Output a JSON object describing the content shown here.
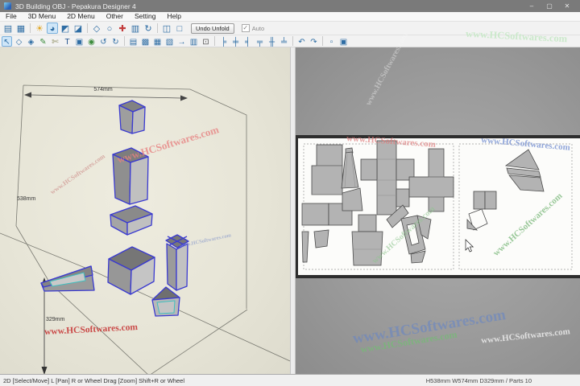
{
  "window": {
    "title": "3D Building OBJ - Pepakura Designer 4",
    "minimize_glyph": "–",
    "maximize_glyph": "▢",
    "close_glyph": "✕"
  },
  "menubar": {
    "items": [
      "File",
      "3D Menu",
      "2D Menu",
      "Other",
      "Setting",
      "Help"
    ]
  },
  "toolbar_top": {
    "icons": [
      {
        "name": "open-file",
        "glyph": "▤",
        "color": "#2e6da4"
      },
      {
        "name": "save-file",
        "glyph": "▦",
        "color": "#2e6da4"
      },
      {
        "sep": true
      },
      {
        "name": "toggle-light",
        "glyph": "☀",
        "color": "#e0a520"
      },
      {
        "name": "rotate-view",
        "glyph": "◕",
        "color": "#2e6da4",
        "selected": true
      },
      {
        "name": "pick-part-front",
        "glyph": "◩",
        "color": "#2e6da4"
      },
      {
        "name": "pick-part-through",
        "glyph": "◪",
        "color": "#2e6da4"
      },
      {
        "sep": true
      },
      {
        "name": "view-cube",
        "glyph": "◇",
        "color": "#2e6da4"
      },
      {
        "name": "view-cylinder",
        "glyph": "○",
        "color": "#2e6da4"
      },
      {
        "name": "show-axes",
        "glyph": "✚",
        "color": "#c23b3b"
      },
      {
        "name": "mirror-model",
        "glyph": "▥",
        "color": "#2e6da4"
      },
      {
        "name": "rotate-model",
        "glyph": "↻",
        "color": "#2e6da4"
      },
      {
        "sep": true
      },
      {
        "name": "layout-3d-2d",
        "glyph": "◫",
        "color": "#2e6da4"
      },
      {
        "name": "layout-2d-only",
        "glyph": "□",
        "color": "#2e6da4"
      }
    ],
    "undo_unfold_label": "Undo Unfold",
    "auto": {
      "label": "Auto",
      "checked": true,
      "check_glyph": "✓"
    }
  },
  "toolbar_2d": {
    "icons": [
      {
        "name": "select-move",
        "glyph": "↖",
        "color": "#2e6da4",
        "selected": true
      },
      {
        "name": "edit-outline",
        "glyph": "◇",
        "color": "#2e6da4"
      },
      {
        "name": "join-divide",
        "glyph": "◈",
        "color": "#2e6da4"
      },
      {
        "name": "draw-line",
        "glyph": "✎",
        "color": "#3c8c3c"
      },
      {
        "name": "erase-line",
        "glyph": "✄",
        "color": "#8a8a5a"
      },
      {
        "name": "insert-text",
        "glyph": "T",
        "color": "#1d4f8c"
      },
      {
        "name": "insert-image",
        "glyph": "▣",
        "color": "#2e6da4"
      },
      {
        "name": "texture-settings",
        "glyph": "◉",
        "color": "#3c8c3c"
      },
      {
        "name": "undo",
        "glyph": "↺",
        "color": "#2e6da4"
      },
      {
        "name": "redo",
        "glyph": "↻",
        "color": "#2e6da4"
      },
      {
        "sep": true
      },
      {
        "name": "check-fold",
        "glyph": "▤",
        "color": "#2e6da4"
      },
      {
        "name": "show-flaps",
        "glyph": "▩",
        "color": "#2e6da4"
      },
      {
        "name": "arrange-parts",
        "glyph": "▦",
        "color": "#2e6da4"
      },
      {
        "name": "add-page",
        "glyph": "▧",
        "color": "#2e6da4"
      },
      {
        "name": "move-part-to-page",
        "glyph": "→",
        "color": "#2e6da4"
      },
      {
        "name": "page-setup",
        "glyph": "▥",
        "color": "#2e6da4"
      },
      {
        "name": "print",
        "glyph": "⊡",
        "color": "#555555"
      },
      {
        "sep": true
      },
      {
        "name": "align-left",
        "glyph": "╞",
        "color": "#2e6da4"
      },
      {
        "name": "align-center-h",
        "glyph": "╪",
        "color": "#2e6da4"
      },
      {
        "name": "align-right",
        "glyph": "╡",
        "color": "#2e6da4"
      },
      {
        "name": "align-top",
        "glyph": "╤",
        "color": "#2e6da4"
      },
      {
        "name": "align-center-v",
        "glyph": "╫",
        "color": "#2e6da4"
      },
      {
        "name": "align-bottom",
        "glyph": "╧",
        "color": "#2e6da4"
      },
      {
        "sep": true
      },
      {
        "name": "rotate-part-left",
        "glyph": "↶",
        "color": "#2e6da4"
      },
      {
        "name": "rotate-part-right",
        "glyph": "↷",
        "color": "#2e6da4"
      },
      {
        "sep": true
      },
      {
        "name": "select-region",
        "glyph": "▫",
        "color": "#2e6da4"
      },
      {
        "name": "select-all-parts",
        "glyph": "▣",
        "color": "#2e6da4"
      }
    ]
  },
  "view3d": {
    "dimensions": {
      "width": "574mm",
      "height": "538mm",
      "depth": "329mm"
    }
  },
  "watermark": {
    "text": "www.HCSoftwares.com"
  },
  "statusbar": {
    "left": "2D [Select/Move] L [Pan] R or Wheel Drag [Zoom] Shift+R or Wheel",
    "right": "H538mm W574mm D329mm / Parts 10"
  }
}
